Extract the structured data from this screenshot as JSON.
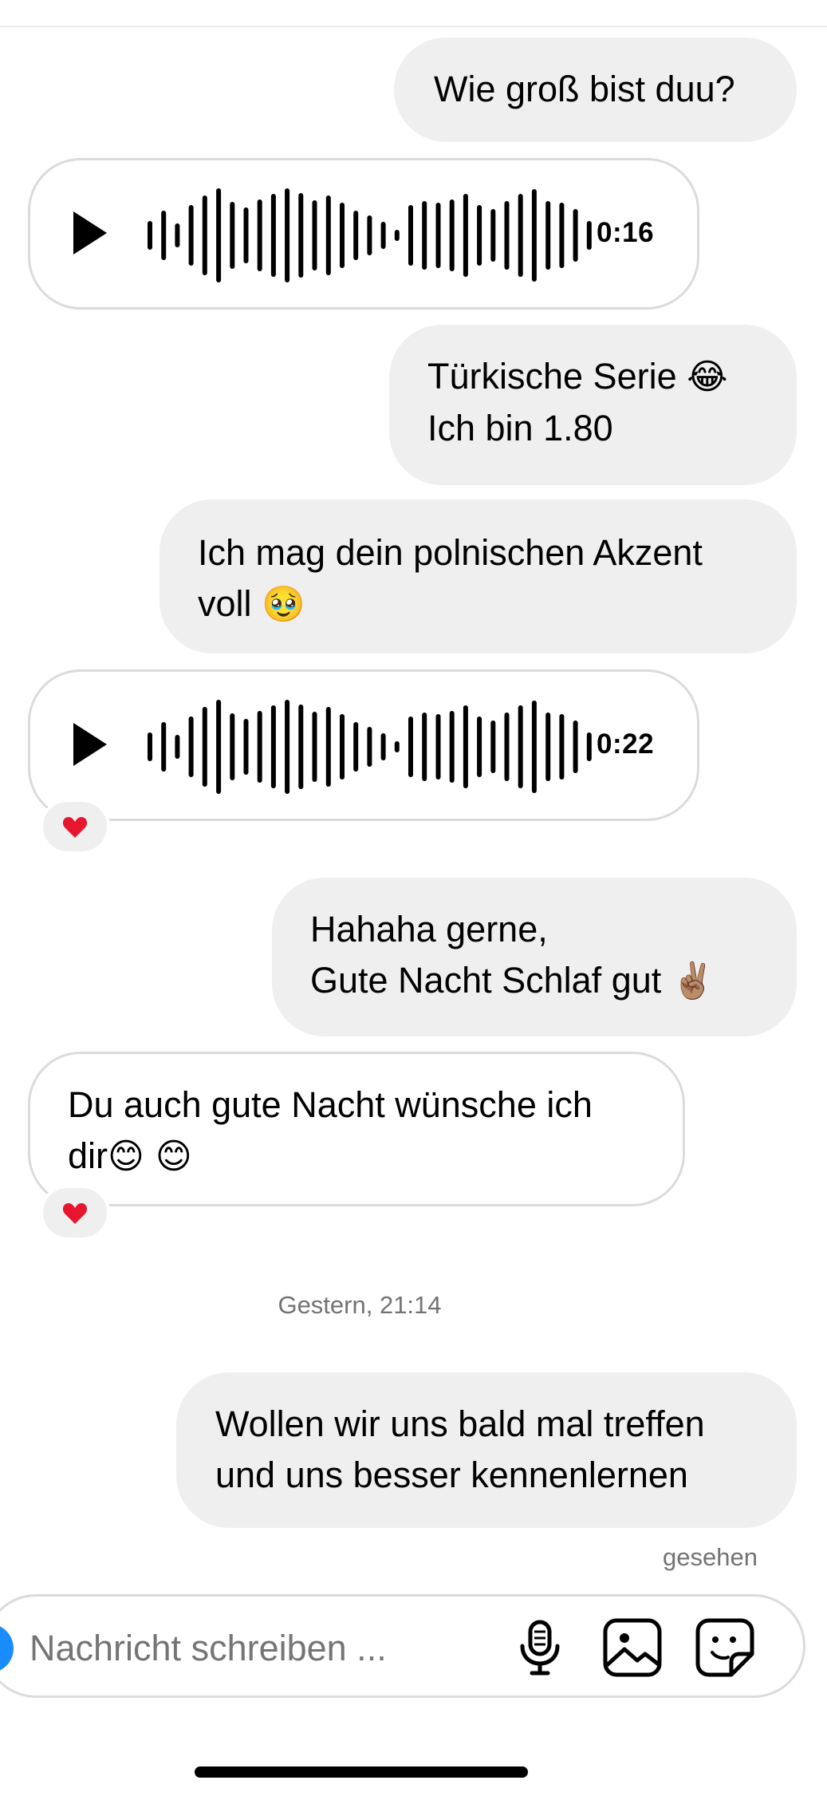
{
  "messages": {
    "m1": {
      "text": "Wie groß bist duu?"
    },
    "a1": {
      "duration": "0:16"
    },
    "m2": {
      "line1": "Türkische Serie ",
      "emoji1": "😂",
      "line2": "Ich bin 1.80"
    },
    "m3": {
      "line1": "Ich mag dein polnischen Akzent",
      "line2": "voll ",
      "emoji1": "🥹"
    },
    "a2": {
      "duration": "0:22",
      "reaction": "❤️"
    },
    "m4": {
      "line1": "Hahaha gerne,",
      "line2": "Gute Nacht Schlaf gut ",
      "emoji1": "✌🏽"
    },
    "m5": {
      "line1": "Du auch gute Nacht wünsche ich",
      "line2": "dir",
      "emoji1": "😊",
      "emoji2": " 😊",
      "reaction": "❤️"
    },
    "timestamp": "Gestern, 21:14",
    "m6": {
      "line1": "Wollen wir uns bald mal treffen",
      "line2": "und uns besser kennenlernen"
    },
    "seen": "gesehen"
  },
  "composer": {
    "placeholder": "Nachricht schreiben ...",
    "icons": [
      "microphone-icon",
      "image-icon",
      "sticker-icon"
    ]
  },
  "colors": {
    "outgoing_bubble": "#efefef",
    "incoming_border": "#dbdbdb",
    "reaction_heart": "#e8152e",
    "camera_button": "#1a8cff",
    "meta_text": "#737373"
  }
}
